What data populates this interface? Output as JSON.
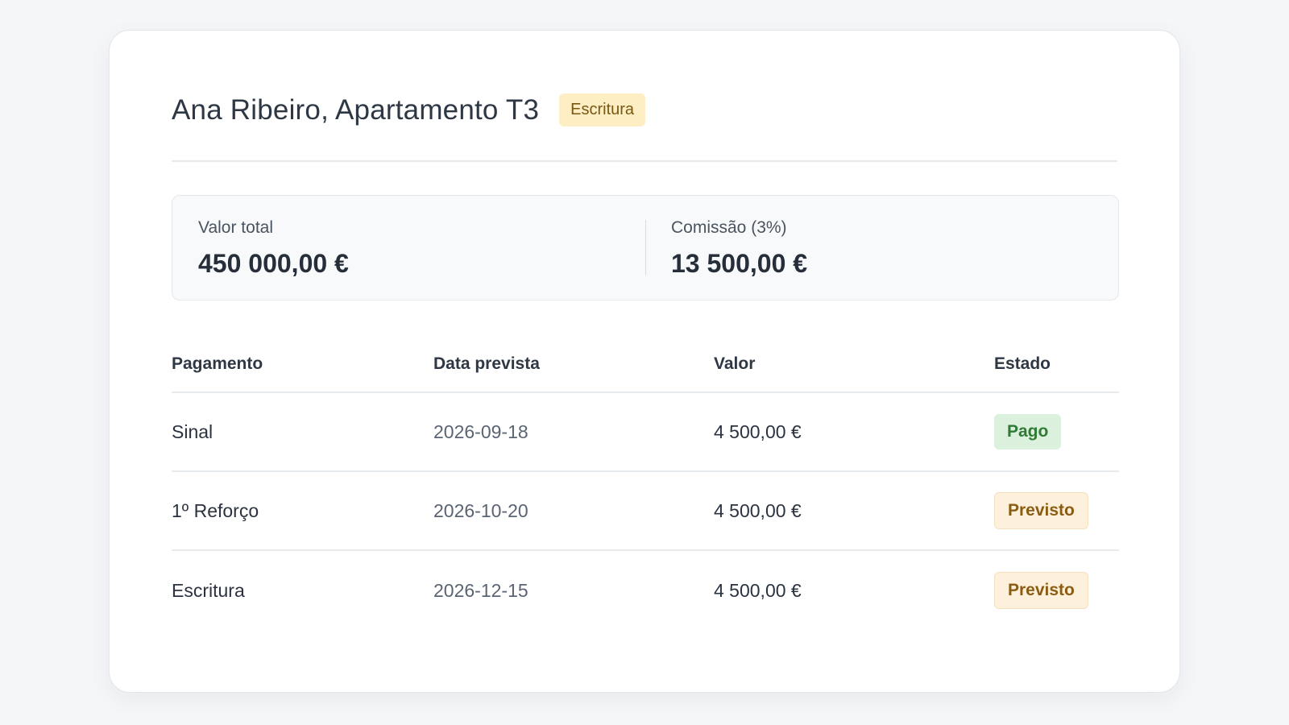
{
  "deal": {
    "title": "Ana Ribeiro, Apartamento T3",
    "stage": "Escritura"
  },
  "summary": {
    "total_label": "Valor total",
    "total_value": "450 000,00 €",
    "commission_label": "Comissão (3%)",
    "commission_value": "13 500,00 €"
  },
  "table": {
    "headers": [
      "Pagamento",
      "Data prevista",
      "Valor",
      "Estado"
    ],
    "rows": [
      {
        "payment": "Sinal",
        "date": "2026-09-18",
        "value": "4 500,00 €",
        "status": "Pago"
      },
      {
        "payment": "1º Reforço",
        "date": "2026-10-20",
        "value": "4 500,00 €",
        "status": "Previsto"
      },
      {
        "payment": "Escritura",
        "date": "2026-12-15",
        "value": "4 500,00 €",
        "status": "Previsto"
      }
    ]
  },
  "colors": {
    "stage_badge_bg": "#fdeec3",
    "paid_badge_bg": "#dcf0de",
    "paid_badge_text": "#2f7a34",
    "planned_badge_bg": "#fdf0dc",
    "planned_badge_text": "#8a5d12"
  }
}
